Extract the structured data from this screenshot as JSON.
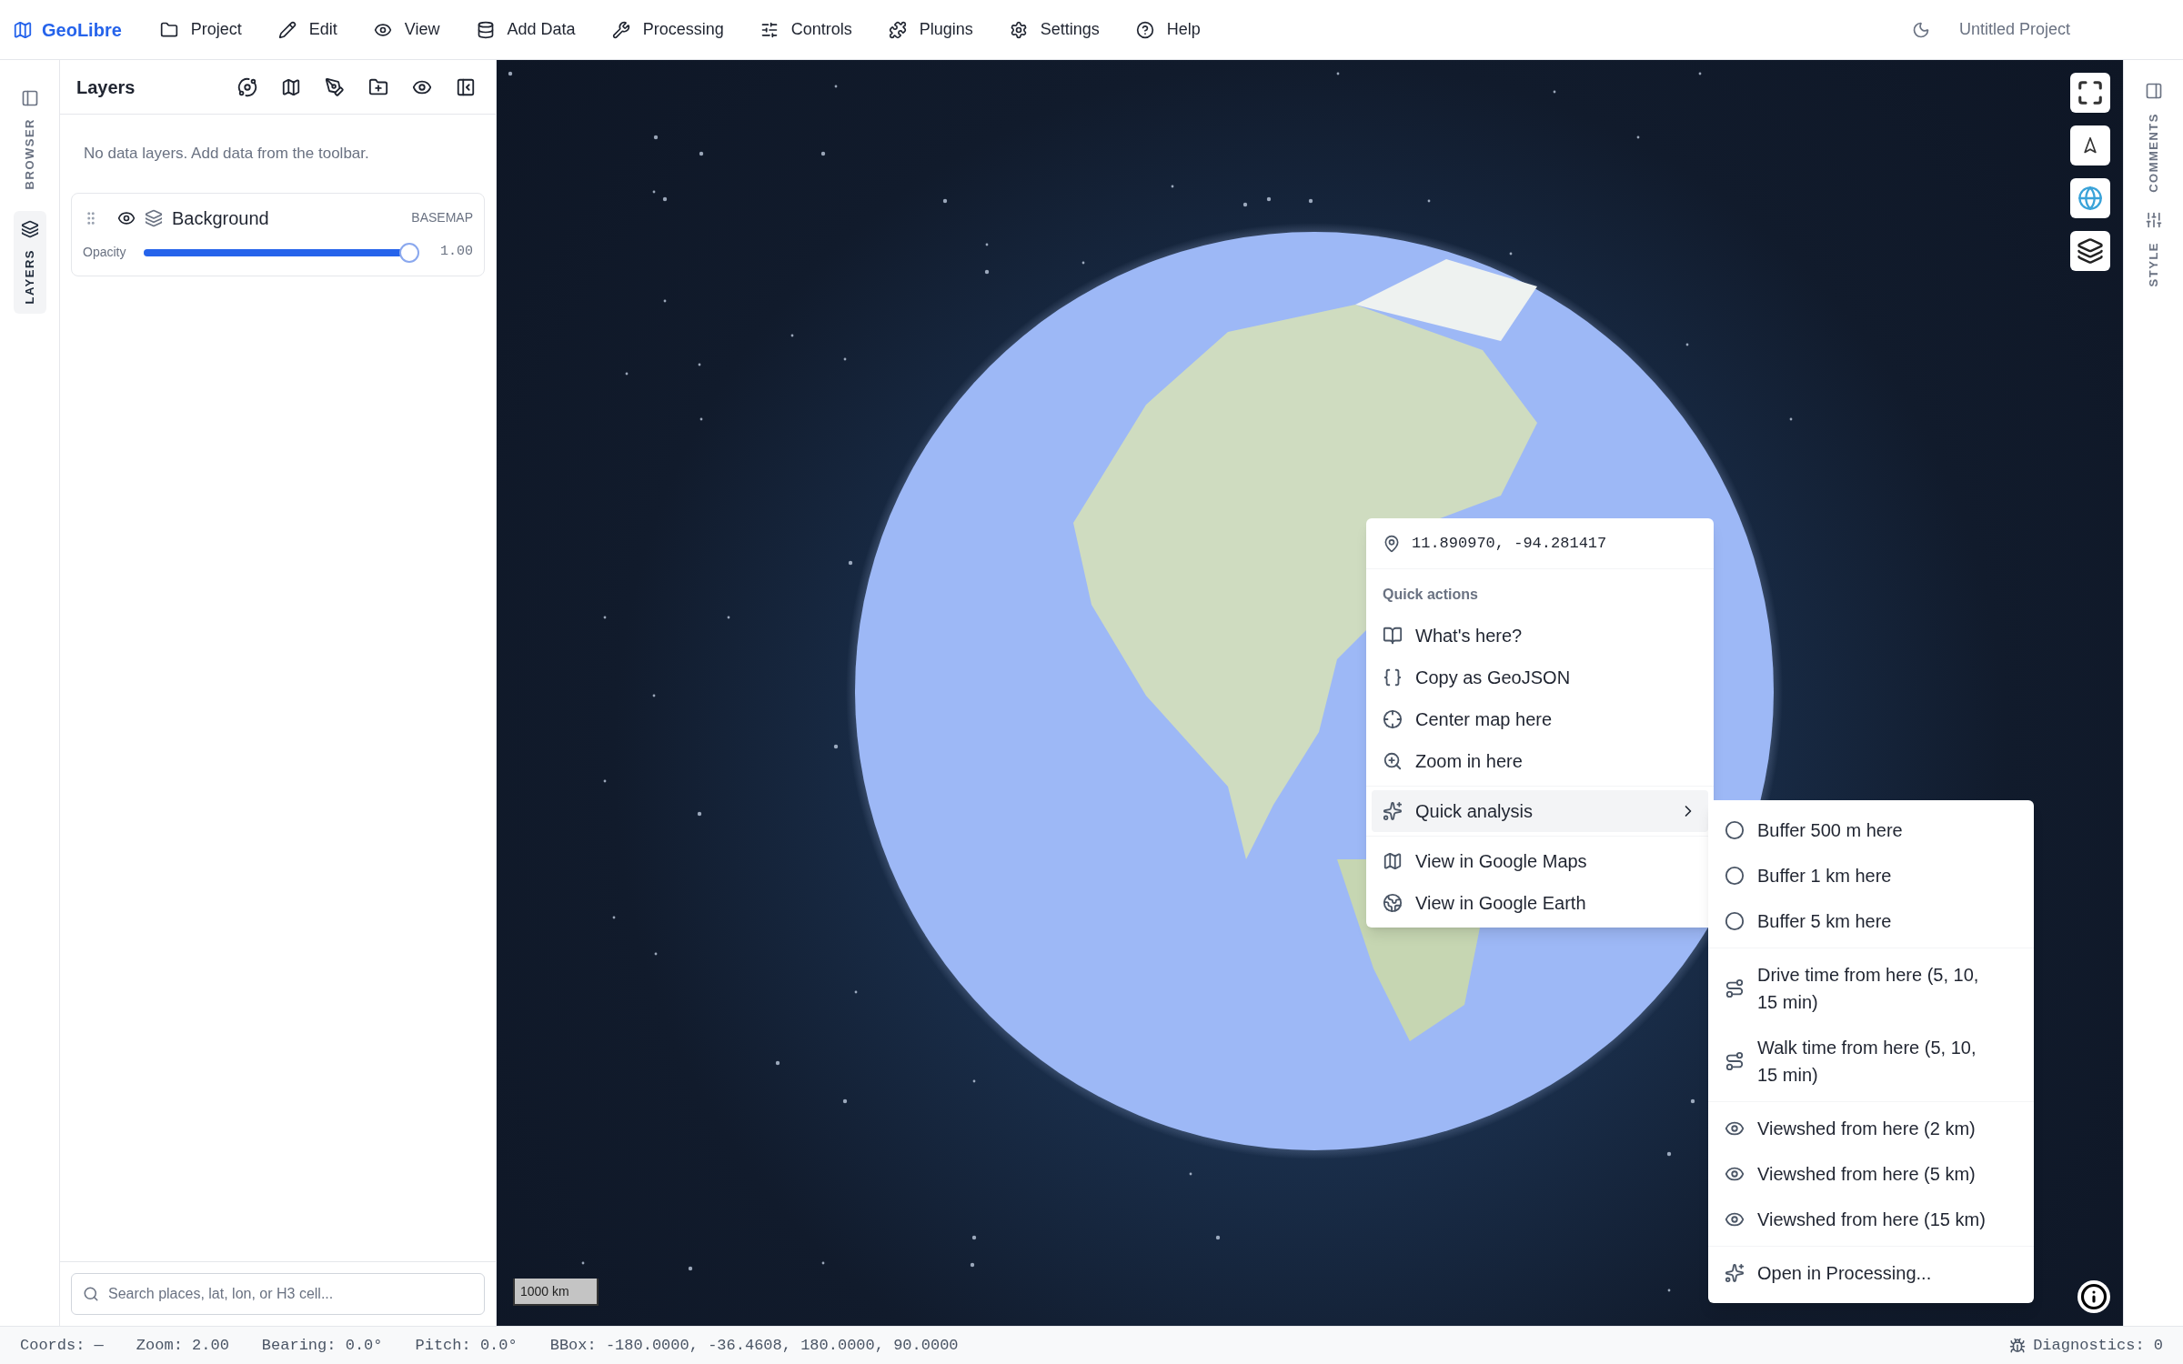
{
  "app": {
    "name": "GeoLibre"
  },
  "menu": [
    {
      "label": "Project"
    },
    {
      "label": "Edit"
    },
    {
      "label": "View"
    },
    {
      "label": "Add Data"
    },
    {
      "label": "Processing"
    },
    {
      "label": "Controls"
    },
    {
      "label": "Plugins"
    },
    {
      "label": "Settings"
    },
    {
      "label": "Help"
    }
  ],
  "project_title": "Untitled Project",
  "left_rail": [
    {
      "label": "BROWSER",
      "selected": false
    },
    {
      "label": "LAYERS",
      "selected": true
    }
  ],
  "layers_panel": {
    "title": "Layers",
    "empty_message": "No data layers. Add data from the toolbar.",
    "layers": [
      {
        "name": "Background",
        "type": "BASEMAP",
        "visible": true,
        "opacity_label": "Opacity",
        "level": 1.0,
        "reading": "1.00"
      }
    ],
    "search": {
      "placeholder": "Search places, lat, lon, or H3 cell..."
    }
  },
  "map": {
    "scale": "1000 km",
    "context_menu": {
      "coords": "11.890970, -94.281417",
      "section": "Quick actions",
      "groups": [
        [
          {
            "label": "What's here?",
            "selected": false,
            "submenu": false
          },
          {
            "label": "Copy as GeoJSON",
            "selected": false,
            "submenu": false
          },
          {
            "label": "Center map here",
            "selected": false,
            "submenu": false
          },
          {
            "label": "Zoom in here",
            "selected": false,
            "submenu": false
          }
        ],
        [
          {
            "label": "Quick analysis",
            "selected": true,
            "submenu": true
          }
        ],
        [
          {
            "label": "View in Google Maps",
            "selected": false,
            "submenu": false
          },
          {
            "label": "View in Google Earth",
            "selected": false,
            "submenu": false
          }
        ]
      ]
    },
    "submenu": {
      "groups": [
        [
          {
            "label": "Buffer 500 m here"
          },
          {
            "label": "Buffer 1 km here"
          },
          {
            "label": "Buffer 5 km here"
          }
        ],
        [
          {
            "label": "Drive time from here (5, 10, 15 min)"
          },
          {
            "label": "Walk time from here (5, 10, 15 min)"
          }
        ],
        [
          {
            "label": "Viewshed from here (2 km)"
          },
          {
            "label": "Viewshed from here (5 km)"
          },
          {
            "label": "Viewshed from here (15 km)"
          }
        ],
        [
          {
            "label": "Open in Processing..."
          }
        ]
      ]
    }
  },
  "right_rail": [
    {
      "label": "COMMENTS"
    },
    {
      "label": "STYLE"
    }
  ],
  "status_bar": {
    "items": [
      "Coords: —",
      "Zoom: 2.00",
      "Bearing: 0.0°",
      "Pitch: 0.0°",
      "BBox: -180.0000, -36.4608, 180.0000, 90.0000"
    ],
    "diagnostics": "Diagnostics: 0"
  }
}
